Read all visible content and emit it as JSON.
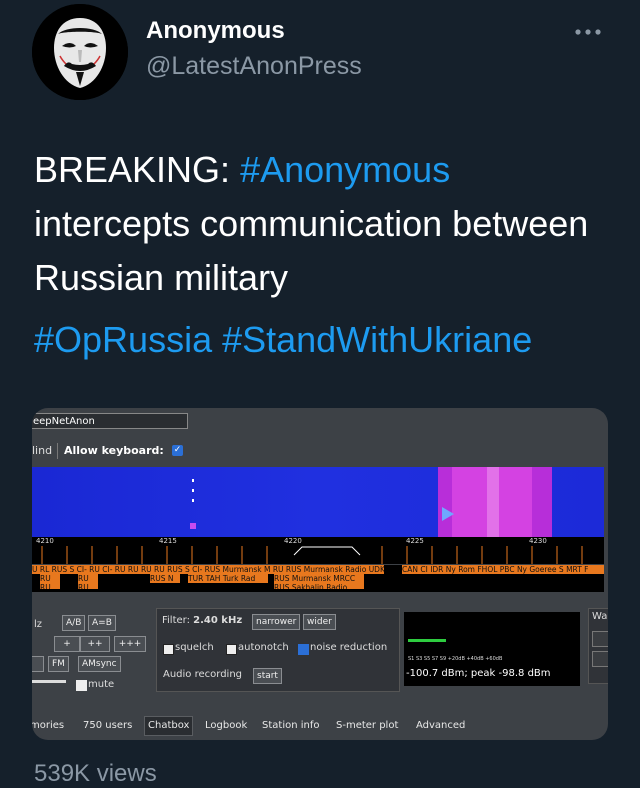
{
  "author": {
    "name": "Anonymous",
    "handle": "@LatestAnonPress"
  },
  "tweet": {
    "prefix": "BREAKING: ",
    "hashtag1": "#Anonymous",
    "body": "intercepts communication between Russian military",
    "hashtags": "#OpRussia #StandWithUkriane",
    "views": "539K views"
  },
  "sdr": {
    "title": "eepNetAnon",
    "blind_label": "lind",
    "allow_keyboard": "Allow keyboard:",
    "scale_ticks": [
      "4210",
      "4215",
      "4220",
      "4225",
      "4230"
    ],
    "stations_row1": [
      "U RL RUS S CI- RU CI- RU RU RU RU RUS S CI- RUS Murmansk M RU RUS Murmansk Radio UDK",
      "CAN CI IDR Ny Rom FHOL PBC Ny Goeree S MRT F"
    ],
    "stations_row2": [
      "RU",
      "RU",
      "RUS N",
      "TUR TAH Turk Rad",
      "RUS Murmansk MRCC"
    ],
    "stations_row3": [
      "RU",
      "RU",
      "RUS Sakhalin Radio"
    ],
    "mode_hz": "lz",
    "ab": "A/B",
    "aeqb": "A=B",
    "plus1": "+",
    "plus2": "++",
    "plus3": "+++",
    "fm": "FM",
    "amsync": "AMsync",
    "mute": "mute",
    "filter_label": "Filter:",
    "filter_value": "2.40 kHz",
    "narrower": "narrower",
    "wider": "wider",
    "squelch": "squelch",
    "autonotch": "autonotch",
    "noise_reduction": "noise reduction",
    "audio_recording": "Audio recording",
    "start": "start",
    "meter_scale": "S1   S3   S5   S7   S9   +20dB   +40dB   +60dB",
    "meter_reading": "-100.7 dBm; peak  -98.8 dBm",
    "wa": "Wa",
    "tabs": [
      "mories",
      "750 users",
      "Chatbox",
      "Logbook",
      "Station info",
      "S-meter plot",
      "Advanced"
    ]
  },
  "colors": {
    "background": "#15202b",
    "link": "#1d9bf0",
    "muted": "#8b98a5",
    "waterfall_blue": "#1d2ad6",
    "waterfall_magenta": "#d233d6",
    "station_orange": "#e8781e"
  },
  "icons": {
    "avatar": "guy-fawkes-mask",
    "more": "more-horizontal-icon"
  }
}
